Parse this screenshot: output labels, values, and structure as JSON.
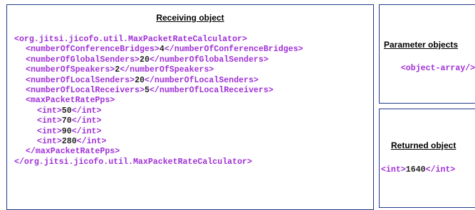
{
  "receiving": {
    "title": "Receiving object",
    "xml_lines": [
      {
        "indent": 0,
        "open": "<org.jitsi.jicofo.util.MaxPacketRateCalculator>",
        "value": "",
        "close": ""
      },
      {
        "indent": 1,
        "open": "<numberOfConferenceBridges>",
        "value": "4",
        "close": "</numberOfConferenceBridges>"
      },
      {
        "indent": 1,
        "open": "<numberOfGlobalSenders>",
        "value": "20",
        "close": "</numberOfGlobalSenders>"
      },
      {
        "indent": 1,
        "open": "<numberOfSpeakers>",
        "value": "2",
        "close": "</numberOfSpeakers>"
      },
      {
        "indent": 1,
        "open": "<numberOfLocalSenders>",
        "value": "20",
        "close": "</numberOfLocalSenders>"
      },
      {
        "indent": 1,
        "open": "<numberOfLocalReceivers>",
        "value": "5",
        "close": "</numberOfLocalReceivers>"
      },
      {
        "indent": 1,
        "open": "<maxPacketRatePps>",
        "value": "",
        "close": ""
      },
      {
        "indent": 2,
        "open": "<int>",
        "value": "50",
        "close": "</int>"
      },
      {
        "indent": 2,
        "open": "<int>",
        "value": "70",
        "close": "</int>"
      },
      {
        "indent": 2,
        "open": "<int>",
        "value": "90",
        "close": "</int>"
      },
      {
        "indent": 2,
        "open": "<int>",
        "value": "280",
        "close": "</int>"
      },
      {
        "indent": 1,
        "open": "</maxPacketRatePps>",
        "value": "",
        "close": ""
      },
      {
        "indent": 0,
        "open": "</org.jitsi.jicofo.util.MaxPacketRateCalculator>",
        "value": "",
        "close": ""
      }
    ]
  },
  "parameters": {
    "title": "Parameter objects",
    "xml": "<object-array/>"
  },
  "returned": {
    "title": "Returned object",
    "open": "<int>",
    "value": "1640",
    "close": "</int>"
  },
  "colors": {
    "panel_border": "#1f3a87",
    "xml_tag": "#9f2fd6",
    "xml_value": "#222222"
  }
}
